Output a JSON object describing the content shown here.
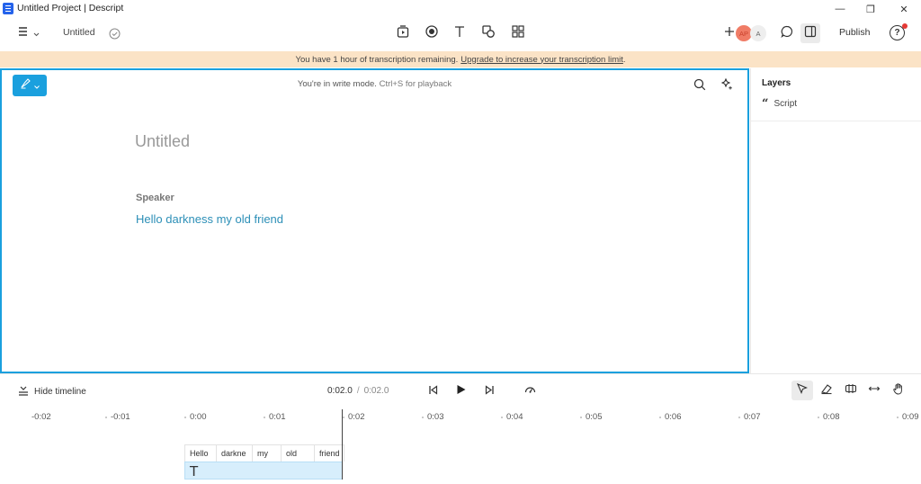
{
  "window": {
    "title": "Untitled Project | Descript",
    "controls": {
      "minimize": "—",
      "maximize": "❐",
      "close": "✕"
    }
  },
  "toolbar": {
    "project_name": "Untitled",
    "avatar_initials": "AP",
    "collaborator_initial": "A",
    "publish_label": "Publish",
    "help_label": "?"
  },
  "banner": {
    "text": "You have 1 hour of transcription remaining.",
    "link": "Upgrade to increase your transcription limit",
    "suffix": "."
  },
  "editor": {
    "mode_text": "You're in write mode.",
    "mode_hint": "Ctrl+S for playback",
    "doc_title": "Untitled",
    "speaker": "Speaker",
    "script_line": "Hello darkness my old friend"
  },
  "layers": {
    "title": "Layers",
    "items": [
      {
        "label": "Script"
      }
    ]
  },
  "timeline": {
    "hide_label": "Hide timeline",
    "current_time": "0:02.0",
    "separator": "/",
    "duration": "0:02.0",
    "ruler": [
      "-0:02",
      "-0:01",
      "0:00",
      "0:01",
      "0:02",
      "0:03",
      "0:04",
      "0:05",
      "0:06",
      "0:07",
      "0:08",
      "0:09"
    ],
    "words": [
      "Hello",
      "darkne",
      "my",
      "old",
      "friend"
    ],
    "text_track_glyph": "T"
  }
}
